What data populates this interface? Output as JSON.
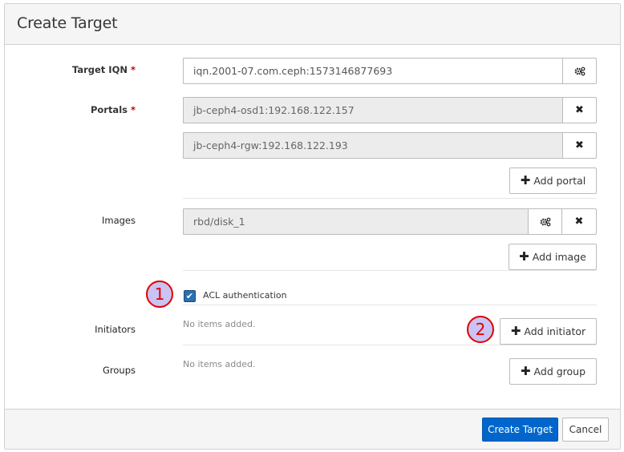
{
  "header": {
    "title": "Create Target"
  },
  "form": {
    "target_iqn": {
      "label": "Target IQN",
      "required_mark": "*",
      "value": "iqn.2001-07.com.ceph:1573146877693",
      "settings_icon": "gears-icon"
    },
    "portals": {
      "label": "Portals",
      "required_mark": "*",
      "items": [
        "jb-ceph4-osd1:192.168.122.157",
        "jb-ceph4-rgw:192.168.122.193"
      ],
      "add_label": "Add portal"
    },
    "images": {
      "label": "Images",
      "items": [
        "rbd/disk_1"
      ],
      "add_label": "Add image"
    },
    "acl": {
      "label": "ACL authentication",
      "checked": true
    },
    "initiators": {
      "label": "Initiators",
      "empty_text": "No items added.",
      "add_label": "Add initiator"
    },
    "groups": {
      "label": "Groups",
      "empty_text": "No items added.",
      "add_label": "Add group"
    }
  },
  "annotations": [
    "1",
    "2"
  ],
  "footer": {
    "submit_label": "Create Target",
    "cancel_label": "Cancel"
  },
  "colors": {
    "primary": "#0066cc",
    "annotation_border": "#e00000",
    "annotation_fill": "#c9c4f4"
  }
}
